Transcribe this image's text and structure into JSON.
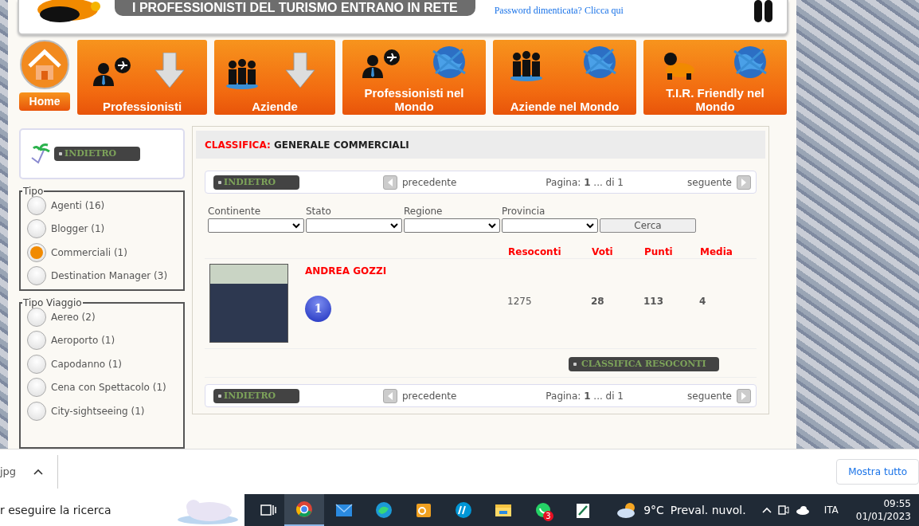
{
  "header": {
    "banner": "I PROFESSIONISTI DEL TURISMO ENTRANO IN RETE",
    "password_link": "Password dimenticata? Clicca qui"
  },
  "nav": [
    {
      "kind": "home",
      "label": "Home"
    },
    {
      "kind": "tile",
      "label": "Professionisti"
    },
    {
      "kind": "tile",
      "label": "Aziende"
    },
    {
      "kind": "tile",
      "label": "Professionisti nel Mondo"
    },
    {
      "kind": "tile",
      "label": "Aziende nel Mondo"
    },
    {
      "kind": "tile",
      "label": "T.I.R. Friendly nel Mondo"
    }
  ],
  "sidebar": {
    "back_button": "INDIETRO",
    "groups": [
      {
        "legend": "Tipo",
        "options": [
          {
            "label": "Agenti (16)",
            "selected": false
          },
          {
            "label": "Blogger (1)",
            "selected": false
          },
          {
            "label": "Commerciali (1)",
            "selected": true
          },
          {
            "label": "Destination Manager (3)",
            "selected": false
          }
        ]
      },
      {
        "legend": "Tipo Viaggio",
        "options": [
          {
            "label": "Aereo (2)",
            "selected": false
          },
          {
            "label": "Aeroporto (1)",
            "selected": false
          },
          {
            "label": "Capodanno (1)",
            "selected": false
          },
          {
            "label": "Cena con Spettacolo (1)",
            "selected": false
          },
          {
            "label": "City-sightseeing (1)",
            "selected": false
          }
        ]
      }
    ]
  },
  "main": {
    "title_label": "CLASSIFICA:",
    "title_value": "GENERALE COMMERCIALI",
    "pager_top": {
      "back": "INDIETRO",
      "prev": "precedente",
      "page": "Pagina: **1** ... di 1",
      "next": "seguente"
    },
    "filters": [
      {
        "label": "Continente"
      },
      {
        "label": "Stato"
      },
      {
        "label": "Regione"
      },
      {
        "label": "Provincia"
      }
    ],
    "search_button": "Cerca",
    "columns": [
      "Resoconti",
      "Voti",
      "Punti",
      "Media"
    ],
    "rows": [
      {
        "name": "ANDREA GOZZI",
        "rank": "1",
        "values": [
          {
            "text": "1275",
            "bold": false
          },
          {
            "text": "28",
            "bold": true
          },
          {
            "text": "113",
            "bold": true
          },
          {
            "text": "4",
            "bold": true
          }
        ]
      }
    ],
    "footer_button": "CLASSIFICA RESOCONTI",
    "pager_bottom": {
      "back": "INDIETRO",
      "prev": "precedente",
      "page": "Pagina: **1** ... di 1",
      "next": "seguente"
    }
  },
  "download_bar": {
    "file": "jpg",
    "show_all": "Mostra tutto"
  },
  "taskbar": {
    "search": "r eseguire la ricerca",
    "apps": [
      {
        "selected": true
      },
      {
        "selected": false
      },
      {
        "selected": false
      },
      {
        "selected": false
      },
      {
        "selected": false
      },
      {
        "selected": false
      },
      {
        "selected": false,
        "badge": "3"
      },
      {
        "selected": false
      }
    ],
    "temperature": "9°C",
    "weather": "Preval. nuvol.",
    "language": "ITA",
    "time": "09:55",
    "date": "01/01/2023"
  }
}
